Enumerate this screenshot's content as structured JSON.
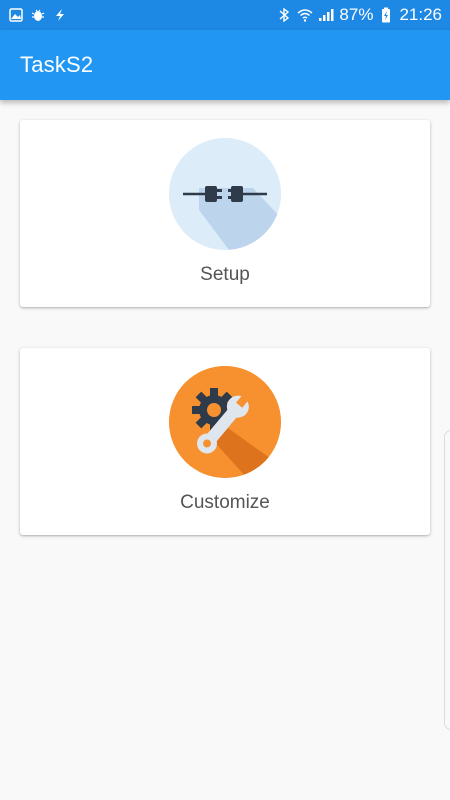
{
  "status_bar": {
    "battery": "87%",
    "time": "21:26",
    "left_icons": [
      "gallery-icon",
      "bug-icon",
      "flash-icon"
    ],
    "right_icons": [
      "bluetooth-icon",
      "wifi-icon",
      "signal-icon",
      "battery-charging-icon"
    ]
  },
  "app_bar": {
    "title": "TaskS2",
    "color": "#2196f3"
  },
  "cards": [
    {
      "label": "Setup",
      "icon": "plug-icon",
      "icon_bg": "#dcecf8"
    },
    {
      "label": "Customize",
      "icon": "wrench-gear-icon",
      "icon_bg": "#f7902e"
    }
  ]
}
